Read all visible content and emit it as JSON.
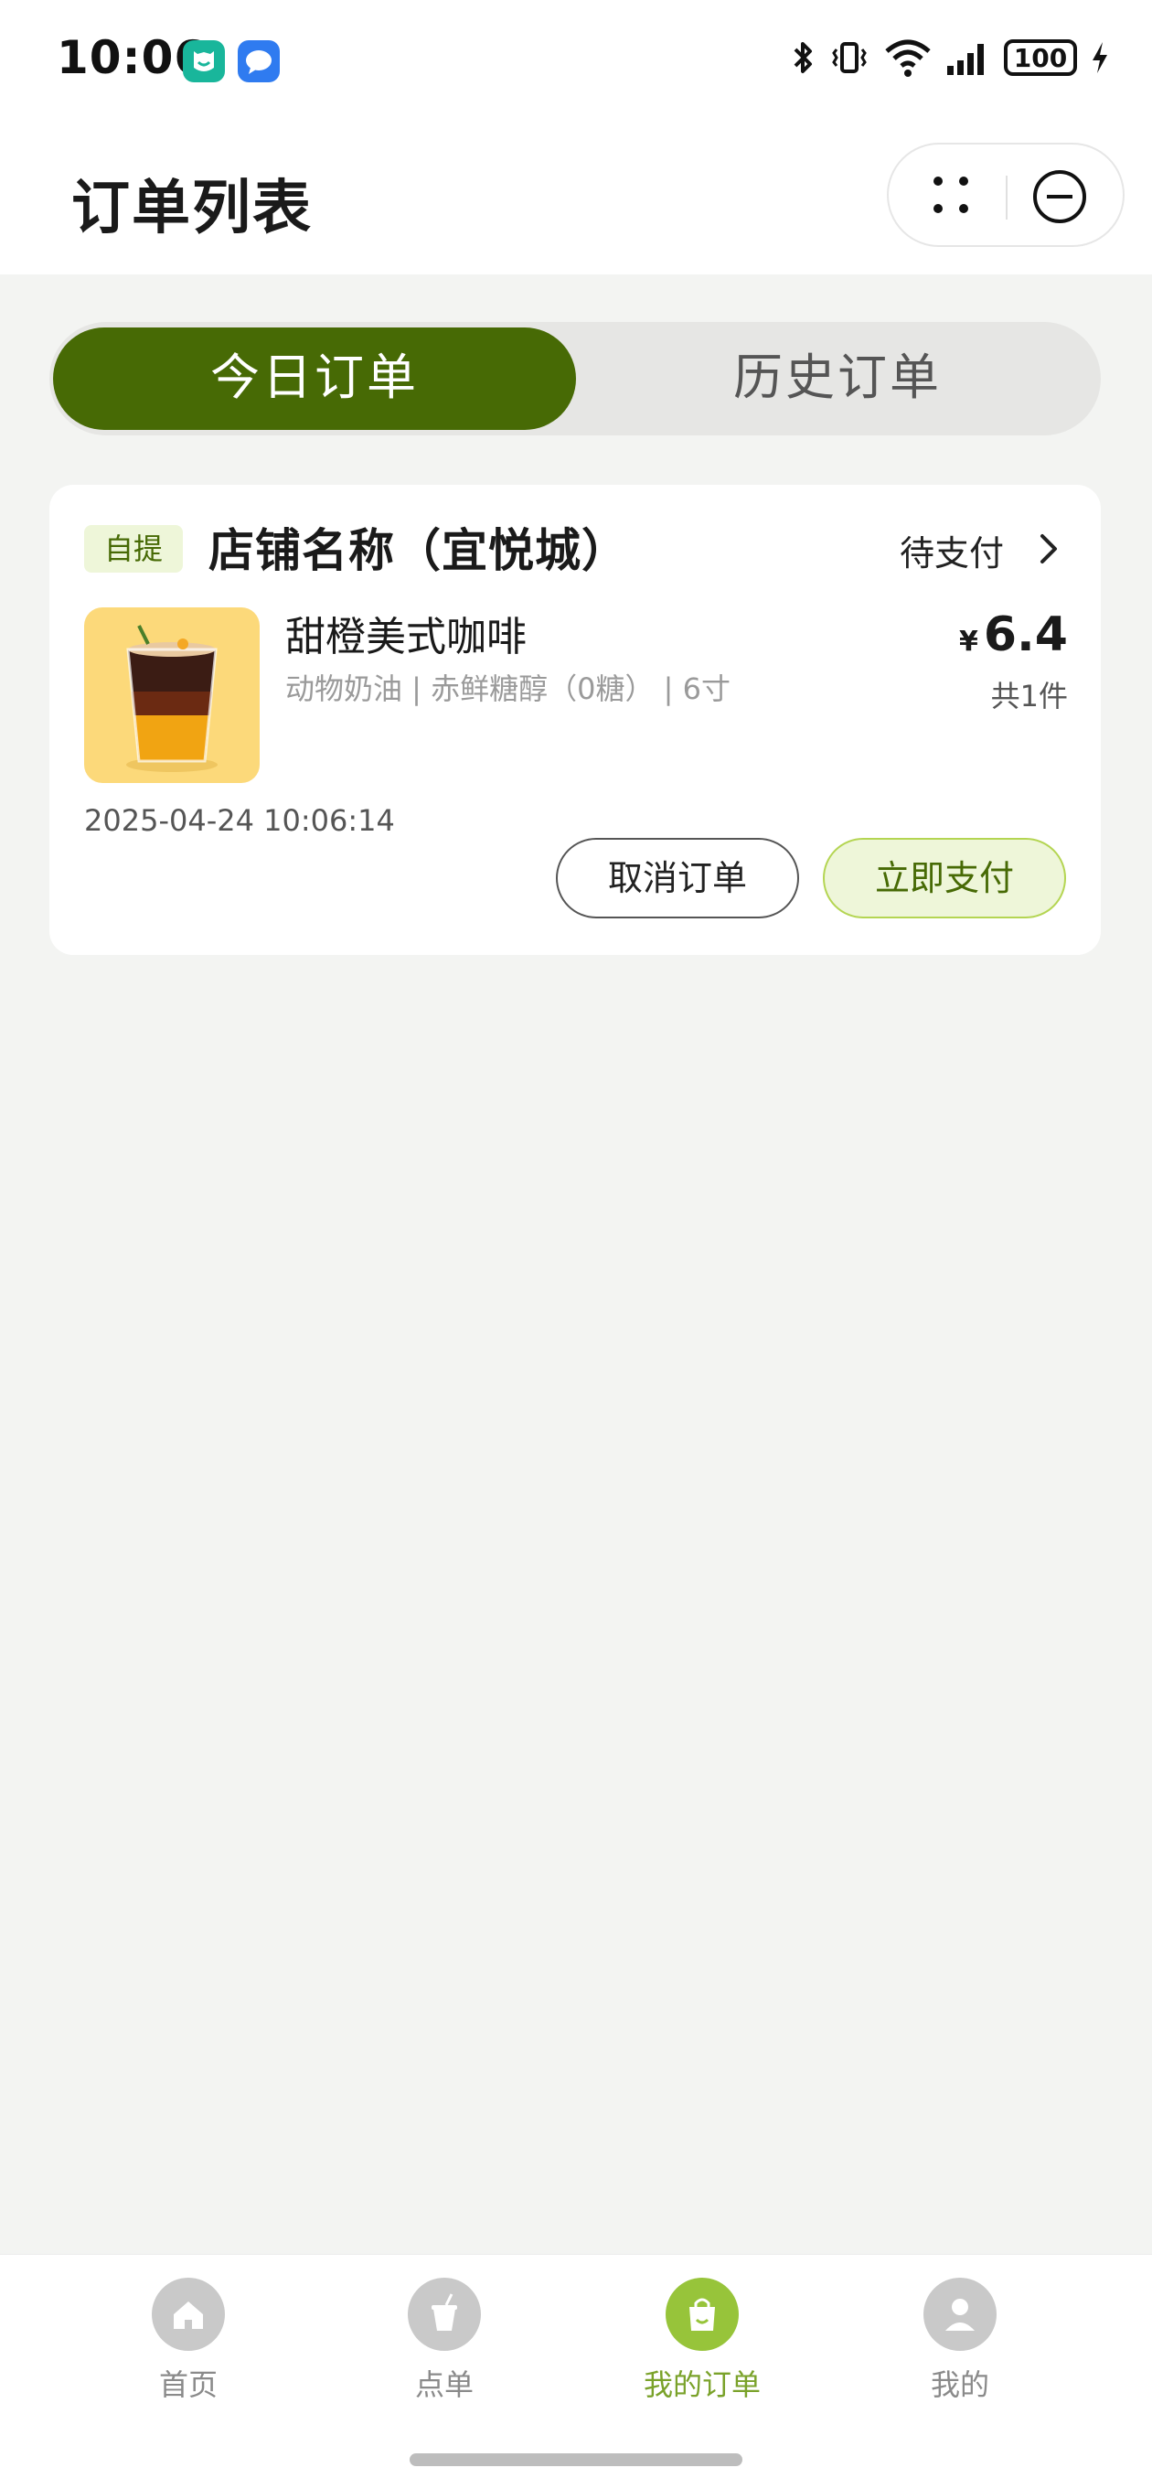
{
  "status_bar": {
    "time": "10:06",
    "battery": "100",
    "icons": [
      "mi-app-icon",
      "message-app-icon",
      "bluetooth-icon",
      "vibrate-icon",
      "wifi-icon",
      "signal-icon",
      "battery-icon",
      "charging-icon"
    ]
  },
  "header": {
    "title": "订单列表",
    "menu_icon": "more-dots-icon",
    "close_icon": "close-circle-icon"
  },
  "tabs": [
    {
      "label": "今日订单",
      "active": true
    },
    {
      "label": "历史订单",
      "active": false
    }
  ],
  "order": {
    "pickup_badge": "自提",
    "shop_name": "店铺名称（宜悦城）",
    "status": "待支付",
    "product": {
      "name": "甜橙美式咖啡",
      "spec": "动物奶油 | 赤鲜糖醇（0糖） | 6寸",
      "image_icon": "iced-coffee-image"
    },
    "currency": "¥",
    "price": "6.4",
    "count": "共1件",
    "datetime": "2025-04-24 10:06:14",
    "cancel_label": "取消订单",
    "pay_label": "立即支付"
  },
  "bottom_nav": [
    {
      "label": "首页",
      "icon": "home-icon",
      "active": false
    },
    {
      "label": "点单",
      "icon": "drink-cup-icon",
      "active": false
    },
    {
      "label": "我的订单",
      "icon": "shopping-bag-icon",
      "active": true
    },
    {
      "label": "我的",
      "icon": "user-icon",
      "active": false
    }
  ],
  "colors": {
    "brand_green": "#476a05",
    "accent_green": "#97c43a",
    "pay_bg": "#eef6d9",
    "background": "#f3f4f2"
  }
}
